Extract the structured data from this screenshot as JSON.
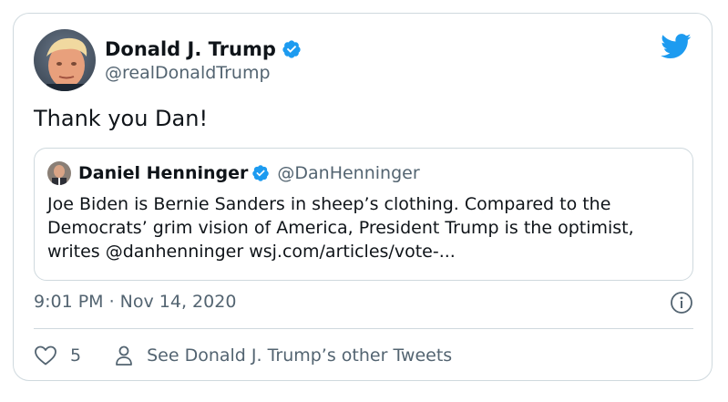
{
  "tweet": {
    "author": {
      "name": "Donald J. Trump",
      "handle": "@realDonaldTrump",
      "verified": true
    },
    "text": "Thank you Dan!",
    "timestamp": "9:01 PM · Nov 14, 2020",
    "likes": "5",
    "other_tweets_label": "See Donald J. Trump’s other Tweets"
  },
  "quoted_tweet": {
    "author": {
      "name": "Daniel Henninger",
      "handle": "@DanHenninger",
      "verified": true
    },
    "text": "Joe Biden is Bernie Sanders in sheep’s clothing. Compared to the Democrats’ grim vision of America, President Trump is the optimist, writes @danhenninger wsj.com/articles/vote-..."
  },
  "icons": {
    "brand": "twitter-bird-icon",
    "verified": "verified-badge-icon",
    "info": "info-icon",
    "like": "heart-icon",
    "profile": "person-icon"
  },
  "colors": {
    "twitter_blue": "#1d9bf0",
    "text_primary": "#0f1419",
    "text_secondary": "#536471",
    "border": "#cfd9de"
  }
}
